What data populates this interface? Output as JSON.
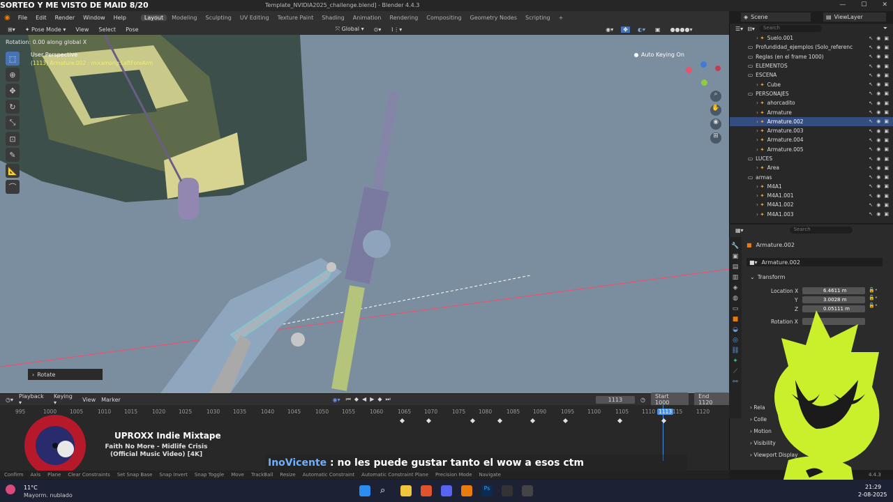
{
  "stream_title": "SORTEO Y ME VISTO DE MAID 8/20",
  "window": {
    "file": "Template_NVIDIA2025_challenge.blend]",
    "app": "- Blender 4.4.3"
  },
  "menu": [
    "File",
    "Edit",
    "Render",
    "Window",
    "Help"
  ],
  "workspaces": [
    "Layout",
    "Modeling",
    "Sculpting",
    "UV Editing",
    "Texture Paint",
    "Shading",
    "Animation",
    "Rendering",
    "Compositing",
    "Geometry Nodes",
    "Scripting"
  ],
  "active_workspace": "Layout",
  "scene_name": "Scene",
  "view_layer": "ViewLayer",
  "viewport": {
    "mode": "Pose Mode",
    "menus": [
      "View",
      "Select",
      "Pose"
    ],
    "orientation": "Global",
    "operation_info": "Rotation: 0.00 along global X",
    "perspective": "User Perspective",
    "object_info": "(1113) Armature.002 : mixamorig:LeftForeArm",
    "auto_keying": "Auto Keying On",
    "last_op_panel": "Rotate"
  },
  "outliner": {
    "search_placeholder": "Search",
    "rows": [
      {
        "name": "Suelo.001",
        "indent": 2
      },
      {
        "name": "Profundidad_ejemplos (Solo_referenc",
        "indent": 1
      },
      {
        "name": "Reglas (en el frame 1000)",
        "indent": 1
      },
      {
        "name": "ELEMENTOS",
        "indent": 1
      },
      {
        "name": "ESCENA",
        "indent": 1
      },
      {
        "name": "Cube",
        "indent": 2
      },
      {
        "name": "PERSONAJES",
        "indent": 1
      },
      {
        "name": "ahorcadito",
        "indent": 2
      },
      {
        "name": "Armature",
        "indent": 2
      },
      {
        "name": "Armature.002",
        "indent": 2,
        "selected": true
      },
      {
        "name": "Armature.003",
        "indent": 2
      },
      {
        "name": "Armature.004",
        "indent": 2
      },
      {
        "name": "Armature.005",
        "indent": 2
      },
      {
        "name": "LUCES",
        "indent": 1
      },
      {
        "name": "Area",
        "indent": 2
      },
      {
        "name": "armas",
        "indent": 1
      },
      {
        "name": "M4A1",
        "indent": 2
      },
      {
        "name": "M4A1.001",
        "indent": 2
      },
      {
        "name": "M4A1.002",
        "indent": 2
      },
      {
        "name": "M4A1.003",
        "indent": 2
      }
    ]
  },
  "properties": {
    "search_placeholder": "Search",
    "object_name": "Armature.002",
    "datablock": "Armature.002",
    "transform_label": "Transform",
    "location_label": "Location X",
    "location": {
      "x": "6.4611 m",
      "y": "3.0028 m",
      "z": "0.05111 m"
    },
    "rotation_label": "Rotation X",
    "axis_y": "Y",
    "axis_z": "Z",
    "sections": [
      "Rela",
      "Colle",
      "Motion",
      "Visibility",
      "Viewport Display"
    ]
  },
  "timeline": {
    "menus": [
      "Playback",
      "Keying",
      "View",
      "Marker"
    ],
    "current_frame": "1113",
    "start_label": "Start",
    "start": "1000",
    "end_label": "End",
    "end": "1120",
    "ticks": [
      "995",
      "1000",
      "1005",
      "1010",
      "1015",
      "1020",
      "1025",
      "1030",
      "1035",
      "1040",
      "1045",
      "1050",
      "1055",
      "1060",
      "1065",
      "1070",
      "1075",
      "1080",
      "1085",
      "1090",
      "1095",
      "1100",
      "1105",
      "1110",
      "1113",
      "115",
      "1120"
    ]
  },
  "status_bar": [
    "Confirm",
    "Axis",
    "Plane",
    "Clear Constraints",
    "Set Snap Base",
    "Snap Invert",
    "Snap Toggle",
    "Move",
    "TrackBall",
    "Resize",
    "Automatic Constraint",
    "Automatic Constraint Plane",
    "Precision Mode",
    "Navigate"
  ],
  "version": "4.4.3",
  "music": {
    "title": "UPROXX Indie Mixtape",
    "track": "Faith No More - Midlife Crisis (Official Music Video) [4K]"
  },
  "chat": {
    "user": "InoVicente",
    "sep": ":",
    "message": "no les puede gustar tanto el wow a esos ctm"
  },
  "weather": {
    "temp": "11°C",
    "desc": "Mayorm. nublado"
  },
  "clock": {
    "time": "21:29",
    "date": "2-08-2025"
  },
  "colors": {
    "accent": "#4772b3",
    "viewport_bg": "#7b8ea0",
    "axis_x": "#e8536e",
    "chat_user": "#6fb0ff",
    "mascot": "#c9f02a"
  }
}
